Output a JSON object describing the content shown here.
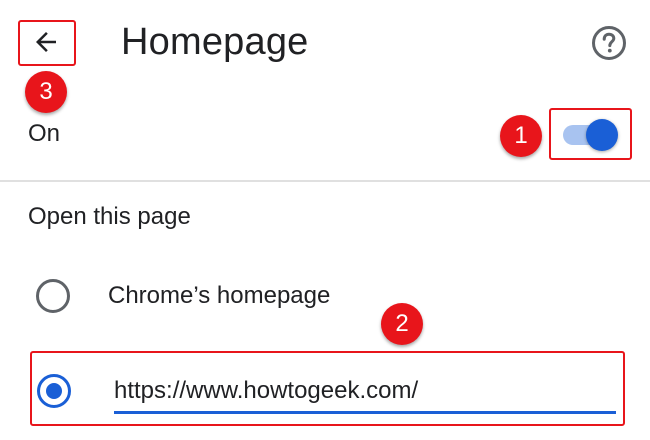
{
  "header": {
    "title": "Homepage",
    "back_icon": "arrow-left-icon",
    "help_icon": "help-circle-icon"
  },
  "homepage_toggle": {
    "label": "On",
    "state": "on",
    "colors": {
      "track": "#a8c3f0",
      "thumb": "#1a5fd6"
    }
  },
  "section": {
    "heading": "Open this page",
    "options": [
      {
        "label": "Chrome’s homepage",
        "selected": false
      },
      {
        "value": "https://www.howtogeek.com/",
        "selected": true
      }
    ]
  },
  "annotations": {
    "color": "#e8151b",
    "badges": [
      "1",
      "2",
      "3"
    ]
  },
  "colors": {
    "accent": "#1a5fd6",
    "text": "#202124",
    "divider": "#e0e0e0"
  }
}
